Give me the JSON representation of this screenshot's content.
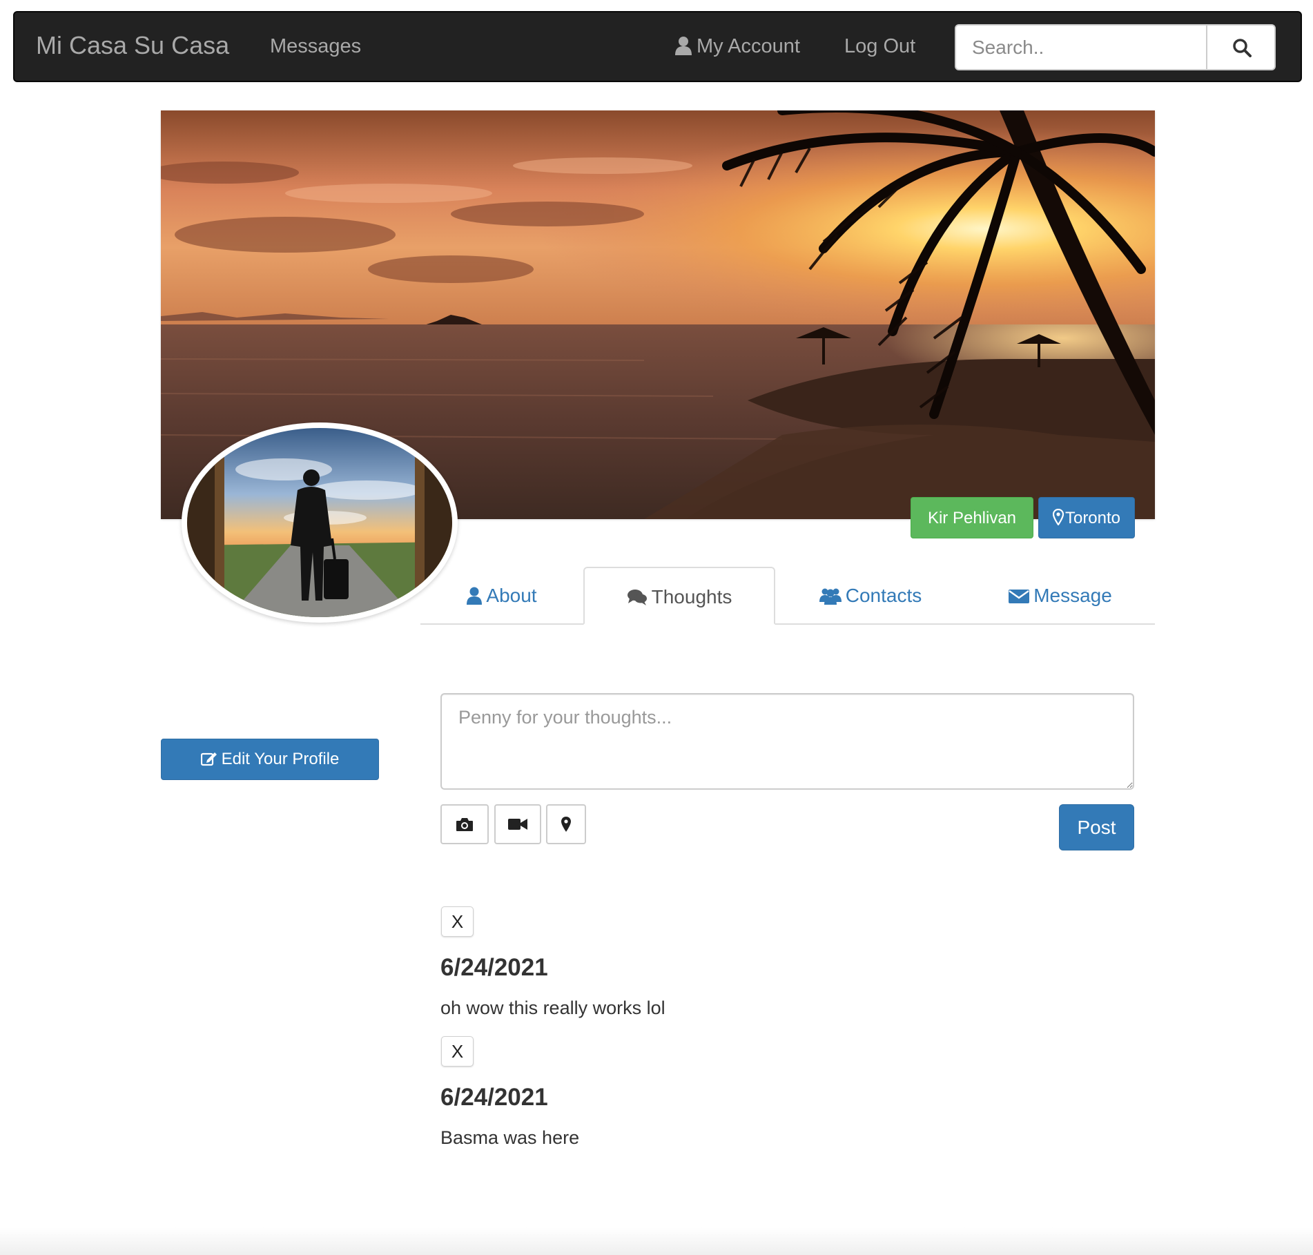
{
  "navbar": {
    "brand": "Mi Casa Su Casa",
    "messages_label": "Messages",
    "account_label": "My Account",
    "logout_label": "Log Out",
    "search_placeholder": "Search..",
    "account_icon": "user-icon",
    "search_icon": "search-icon"
  },
  "profile": {
    "name": "Kir Pehlivan",
    "location": "Toronto",
    "location_icon": "map-marker-icon",
    "edit_label": "Edit Your Profile",
    "edit_icon": "edit-icon"
  },
  "tabs": [
    {
      "label": "About",
      "icon": "user-icon",
      "active": false
    },
    {
      "label": "Thoughts",
      "icon": "comments-icon",
      "active": true
    },
    {
      "label": "Contacts",
      "icon": "users-icon",
      "active": false
    },
    {
      "label": "Message",
      "icon": "envelope-icon",
      "active": false
    }
  ],
  "composer": {
    "placeholder": "Penny for your thoughts...",
    "post_label": "Post",
    "tools": [
      "camera-icon",
      "video-icon",
      "map-marker-icon"
    ]
  },
  "posts": [
    {
      "delete_label": "X",
      "date": "6/24/2021",
      "text": "oh wow this really works lol"
    },
    {
      "delete_label": "X",
      "date": "6/24/2021",
      "text": "Basma was here"
    }
  ],
  "colors": {
    "navbar_bg": "#222222",
    "primary": "#337ab7",
    "success": "#5cb85c",
    "nav_text": "#a9a9a9"
  }
}
